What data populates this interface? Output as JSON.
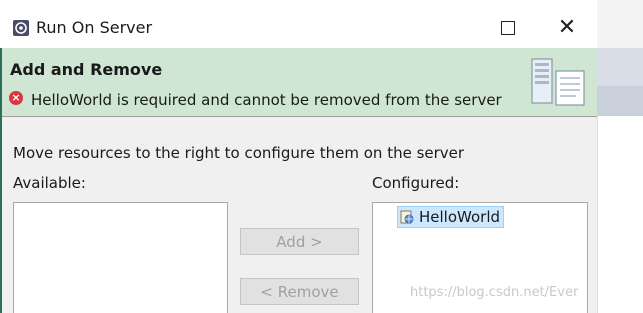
{
  "window": {
    "title": "Run On Server",
    "icon": "server-run-icon",
    "maximize_icon": "maximize-icon",
    "close_glyph": "✕"
  },
  "header": {
    "title": "Add and Remove",
    "error_icon": "error-icon",
    "error_message": "HelloWorld is required and cannot be removed from the server",
    "wizard_icon": "server-wizard-icon"
  },
  "body": {
    "description": "Move resources to the right to configure them on the server",
    "available_label": "Available:",
    "configured_label": "Configured:",
    "available_items": [],
    "configured_items": [
      {
        "label": "HelloWorld",
        "icon": "web-module-icon",
        "selected": true
      }
    ]
  },
  "buttons": {
    "add_label": "Add >",
    "remove_label": "< Remove"
  },
  "watermark": "https://blog.csdn.net/Ever",
  "colors": {
    "header_bg": "#cfe6d3",
    "error": "#d9363e",
    "selection": "#cce8ff"
  }
}
